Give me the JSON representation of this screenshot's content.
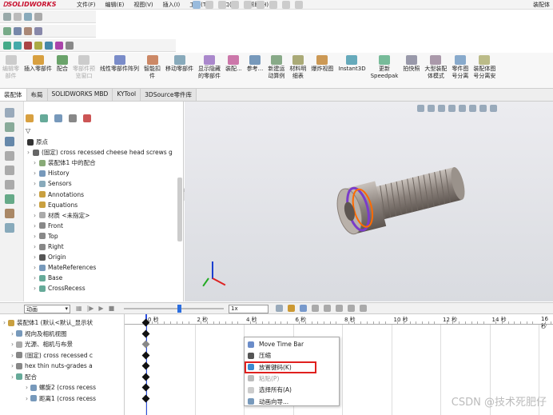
{
  "brand": "SOLIDWORKS",
  "menu": [
    "文件(F)",
    "编辑(E)",
    "视图(V)",
    "插入(I)",
    "工具(T)",
    "窗口(W)",
    "帮助(H)"
  ],
  "title_right": "装配体",
  "commands": [
    {
      "label": "编辑零\n部件",
      "disabled": true
    },
    {
      "label": "插入零部件",
      "disabled": false
    },
    {
      "label": "配合",
      "disabled": false
    },
    {
      "label": "零部件预\n览窗口",
      "disabled": true
    },
    {
      "label": "线性零部件阵列",
      "disabled": false
    },
    {
      "label": "智能扣\n件",
      "disabled": false
    },
    {
      "label": "移动零部件",
      "disabled": false
    },
    {
      "label": "显示隐藏\n的零部件",
      "disabled": false
    },
    {
      "label": "装配...",
      "disabled": false
    },
    {
      "label": "参考...",
      "disabled": false
    },
    {
      "label": "新建运\n动算例",
      "disabled": false
    },
    {
      "label": "材料明\n细表",
      "disabled": false
    },
    {
      "label": "爆炸视图",
      "disabled": false
    },
    {
      "label": "Instant3D",
      "disabled": false
    },
    {
      "label": "更新\nSpeedpak",
      "disabled": false
    },
    {
      "label": "拍快照",
      "disabled": false
    },
    {
      "label": "大型装配\n体模式",
      "disabled": false
    },
    {
      "label": "零件图\n号分离",
      "disabled": false
    },
    {
      "label": "装配体图\n号分离安",
      "disabled": false
    }
  ],
  "tabs": [
    "装配体",
    "布局",
    "SOLIDWORKS MBD",
    "KYTool",
    "3DSource零件库"
  ],
  "tree": [
    {
      "text": "原点",
      "indent": 0
    },
    {
      "text": "(固定) cross recessed cheese head screws g",
      "indent": 0
    },
    {
      "text": "装配体1 中的配合",
      "indent": 1
    },
    {
      "text": "History",
      "indent": 1
    },
    {
      "text": "Sensors",
      "indent": 1
    },
    {
      "text": "Annotations",
      "indent": 1
    },
    {
      "text": "Equations",
      "indent": 1
    },
    {
      "text": "材质 <未指定>",
      "indent": 1
    },
    {
      "text": "Front",
      "indent": 1
    },
    {
      "text": "Top",
      "indent": 1
    },
    {
      "text": "Right",
      "indent": 1
    },
    {
      "text": "Origin",
      "indent": 1
    },
    {
      "text": "MateReferences",
      "indent": 1
    },
    {
      "text": "Base",
      "indent": 1
    },
    {
      "text": "CrossRecess",
      "indent": 1
    }
  ],
  "motion": {
    "study_type": "动画",
    "speed": "1x"
  },
  "time_ticks": [
    "0 秒",
    "2 秒",
    "4 秒",
    "6 秒",
    "8 秒",
    "10 秒",
    "12 秒",
    "14 秒",
    "16 秒"
  ],
  "motion_tree": [
    "装配体1 (默认<默认_显示状",
    "视向及相机视图",
    "光源、相机与布景",
    "(固定) cross recessed c",
    "hex thin nuts-grades a",
    "配合",
    "螺旋2 (cross recess",
    "距离1 (cross recess"
  ],
  "context_menu": [
    {
      "label": "Move Time Bar",
      "disabled": false
    },
    {
      "label": "压缩",
      "disabled": false
    },
    {
      "label": "放置键码(K)",
      "disabled": false,
      "highlight": true
    },
    {
      "label": "粘贴(P)",
      "disabled": true
    },
    {
      "label": "选择所有(A)",
      "disabled": false
    },
    {
      "label": "动画向导...",
      "disabled": false
    }
  ],
  "watermark": "CSDN @技术死肥仔"
}
